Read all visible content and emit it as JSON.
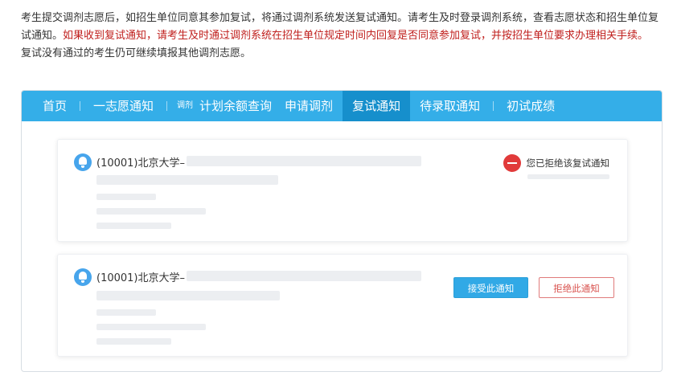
{
  "intro": {
    "line1": "考生提交调剂志愿后，如招生单位同意其参加复试，将通过调剂系统发送复试通知。请考生及时登录调剂系统，查看志愿状态和招生单位复试通知。",
    "line1_warn": "如果收到复试通知，请考生及时通过调剂系统在招生单位规定时间内回复是否同意参加复试，并按招生单位要求办理相关手续。",
    "line3": "复试没有通过的考生仍可继续填报其他调剂志愿。"
  },
  "nav": {
    "home": "首页",
    "first_choice": "一志愿通知",
    "adjust_small": "调剂",
    "quota_query": "计划余额查询",
    "apply_adjust": "申请调剂",
    "retest_notice": "复试通知",
    "admission_notice": "待录取通知",
    "preliminary_score": "初试成绩",
    "active_tab": "复试通知"
  },
  "notices": [
    {
      "title": "(10001)北京大学–",
      "status_text": "您已拒绝该复试通知",
      "status_color": "#e13a3a"
    },
    {
      "title": "(10001)北京大学–",
      "accept_label": "接受此通知",
      "reject_label": "拒绝此通知",
      "accent_color": "#31a9e6"
    }
  ]
}
